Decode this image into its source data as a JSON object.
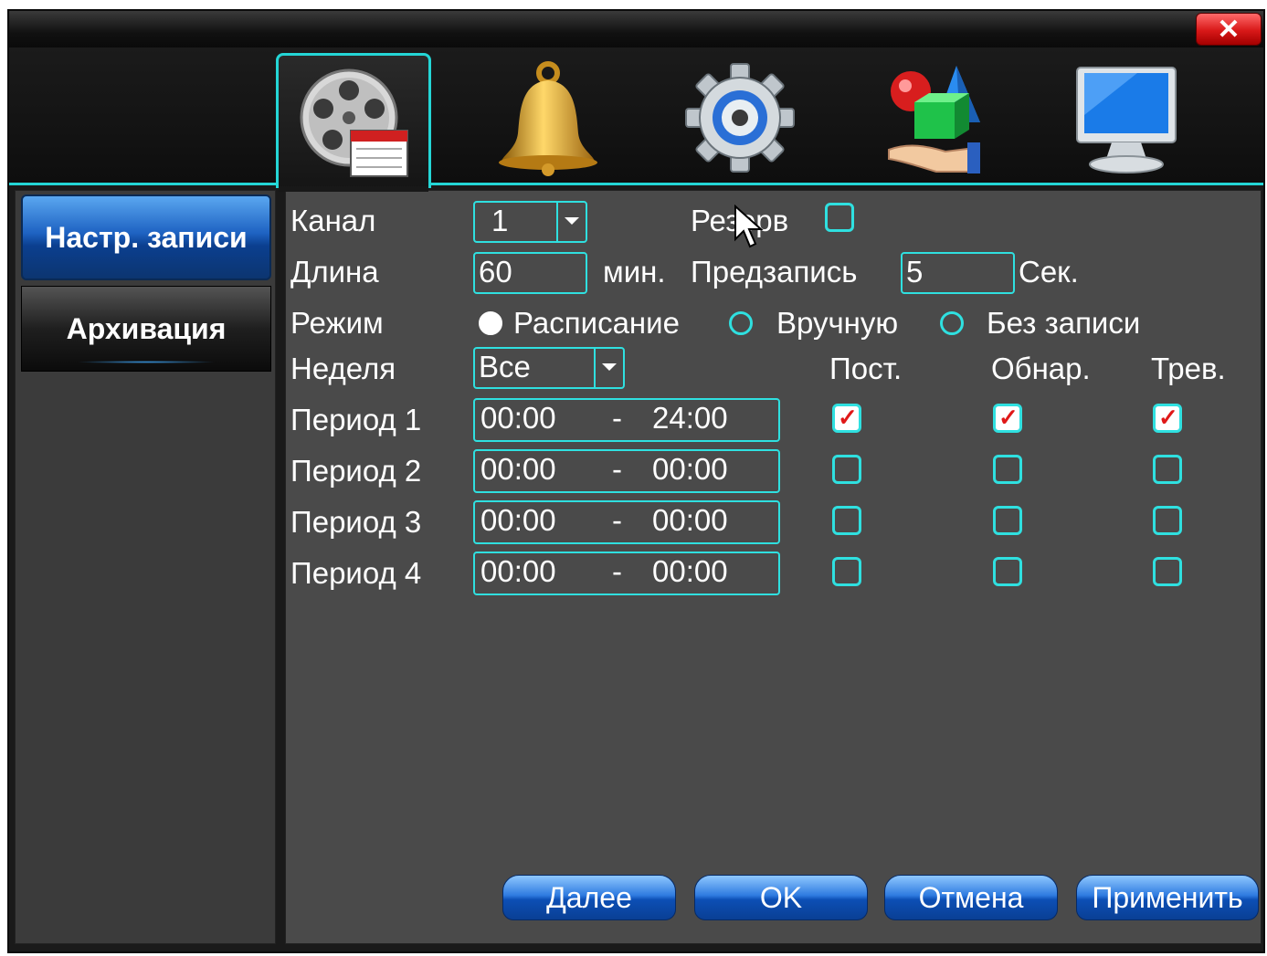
{
  "window": {
    "close_symbol": "✕"
  },
  "tabs": [
    {
      "icon": "film-reel-icon",
      "active": true
    },
    {
      "icon": "bell-icon",
      "active": false
    },
    {
      "icon": "gear-icon",
      "active": false
    },
    {
      "icon": "shapes-icon",
      "active": false
    },
    {
      "icon": "monitor-icon",
      "active": false
    }
  ],
  "sidebar": {
    "items": [
      {
        "label": "Настр. записи",
        "active": true
      },
      {
        "label": "Архивация",
        "active": false
      }
    ]
  },
  "form": {
    "channel_label": "Канал",
    "channel_value": "1",
    "reserve_label": "Резерв",
    "reserve_checked": false,
    "length_label": "Длина",
    "length_value": "60",
    "length_unit": "мин.",
    "prerecord_label": "Предзапись",
    "prerecord_value": "5",
    "prerecord_unit": "Сек.",
    "mode_label": "Режим",
    "mode_options": [
      {
        "label": "Расписание",
        "selected": true
      },
      {
        "label": "Вручную",
        "selected": false
      },
      {
        "label": "Без записи",
        "selected": false
      }
    ],
    "week_label": "Неделя",
    "week_value": "Все",
    "col_constant": "Пост.",
    "col_detect": "Обнар.",
    "col_alarm": "Трев.",
    "periods": [
      {
        "label": "Период 1",
        "start": "00:00",
        "sep": "-",
        "end": "24:00",
        "constant": true,
        "detect": true,
        "alarm": true
      },
      {
        "label": "Период 2",
        "start": "00:00",
        "sep": "-",
        "end": "00:00",
        "constant": false,
        "detect": false,
        "alarm": false
      },
      {
        "label": "Период 3",
        "start": "00:00",
        "sep": "-",
        "end": "00:00",
        "constant": false,
        "detect": false,
        "alarm": false
      },
      {
        "label": "Период 4",
        "start": "00:00",
        "sep": "-",
        "end": "00:00",
        "constant": false,
        "detect": false,
        "alarm": false
      }
    ]
  },
  "buttons": {
    "next": "Далее",
    "ok": "OK",
    "cancel": "Отмена",
    "apply": "Применить"
  },
  "colors": {
    "accent": "#2fe0e0",
    "panel": "#4a4a4a",
    "button_blue": "#2f7be0",
    "close_red": "#d81818"
  }
}
